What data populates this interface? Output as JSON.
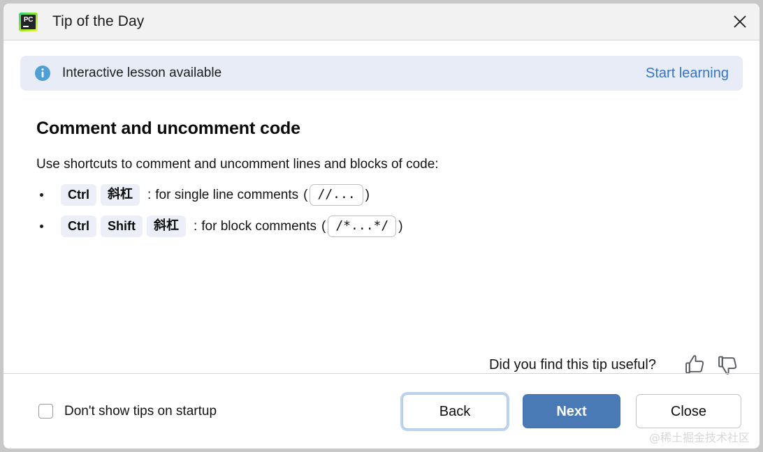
{
  "window": {
    "title": "Tip of the Day",
    "app_icon": "pycharm-icon",
    "app_icon_text": "PC",
    "close_icon": "close-icon"
  },
  "banner": {
    "icon": "info-icon",
    "message": "Interactive lesson available",
    "action_label": "Start learning",
    "background_color": "#e7ecf7",
    "link_color": "#3574c8"
  },
  "tip": {
    "heading": "Comment and uncomment code",
    "intro": "Use shortcuts to comment and uncomment lines and blocks of code:",
    "bullets": [
      {
        "keys": [
          "Ctrl",
          "斜杠"
        ],
        "separator": ":",
        "description": "for single line comments",
        "open_paren": "(",
        "code": "//...",
        "close_paren": ")"
      },
      {
        "keys": [
          "Ctrl",
          "Shift",
          "斜杠"
        ],
        "separator": ":",
        "description": "for block comments",
        "open_paren": "(",
        "code": "/*...*/",
        "close_paren": ")"
      }
    ]
  },
  "feedback": {
    "question": "Did you find this tip useful?",
    "thumbs_up_icon": "thumbs-up-icon",
    "thumbs_down_icon": "thumbs-down-icon"
  },
  "footer": {
    "checkbox_label": "Don't show tips on startup",
    "checkbox_checked": false,
    "buttons": {
      "back": "Back",
      "next": "Next",
      "close": "Close"
    },
    "next_button_color": "#4a7ab5"
  },
  "watermark": "@稀土掘金技术社区"
}
